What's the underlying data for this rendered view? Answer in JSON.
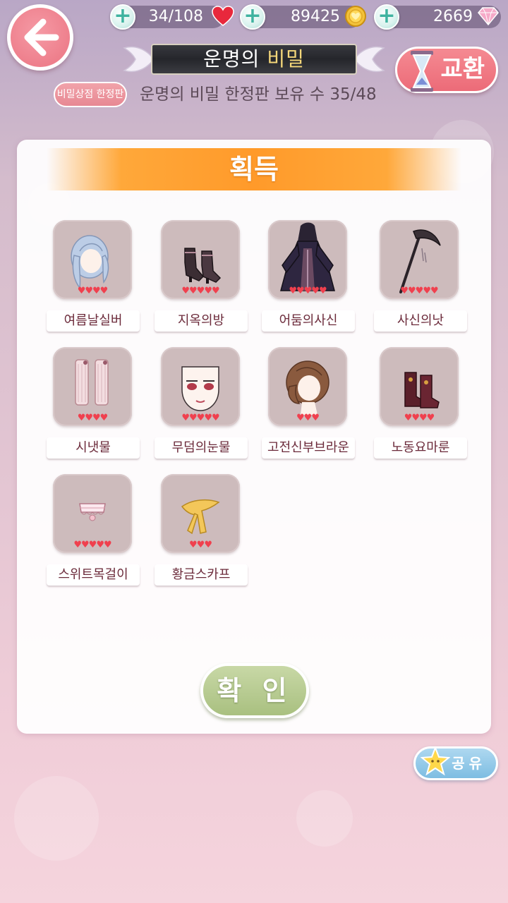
{
  "resources": {
    "hearts": "34/108",
    "gold": "89425",
    "diamonds": "2669",
    "plus_symbol": "+"
  },
  "header": {
    "title_part1": "운명의",
    "title_part2": "비밀",
    "exchange_label": "교환",
    "limited_badge": "비밀상점 한정판",
    "owned_text": "운명의 비밀 한정판 보유 수 35/48"
  },
  "panel": {
    "banner": "획득",
    "items": [
      {
        "name": "여름날실버",
        "hearts": "♥♥♥♥",
        "icon": "hair-icon"
      },
      {
        "name": "지옥의방",
        "hearts": "♥♥♥♥♥",
        "icon": "shoes-icon"
      },
      {
        "name": "어둠의사신",
        "hearts": "♥♥♥♥♥",
        "icon": "dress-icon"
      },
      {
        "name": "사신의낫",
        "hearts": "♥♥♥♥♥",
        "icon": "scythe-icon"
      },
      {
        "name": "시냇물",
        "hearts": "♥♥♥♥",
        "icon": "socks-icon"
      },
      {
        "name": "무덤의눈물",
        "hearts": "♥♥♥♥♥",
        "icon": "face-icon"
      },
      {
        "name": "고전신부브라운",
        "hearts": "♥♥♥",
        "icon": "hair-icon"
      },
      {
        "name": "노동요마룬",
        "hearts": "♥♥♥♥",
        "icon": "boots-icon"
      },
      {
        "name": "스위트목걸이",
        "hearts": "♥♥♥♥♥",
        "icon": "necklace-icon"
      },
      {
        "name": "황금스카프",
        "hearts": "♥♥♥",
        "icon": "scarf-icon"
      }
    ],
    "confirm_label": "확 인"
  },
  "share_label": "공유",
  "colors": {
    "accent_pink": "#ec6b78",
    "banner_orange": "#ff9a2a",
    "confirm_green": "#a9c080",
    "label_text": "#6b2a3a",
    "heart_red": "#f0404e"
  }
}
